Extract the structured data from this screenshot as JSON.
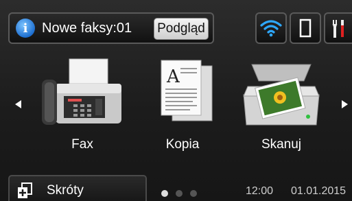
{
  "header": {
    "notification_text": "Nowe faksy:01",
    "preview_label": "Podgląd",
    "info_icon": "info-icon",
    "wifi_icon": "wifi-icon",
    "toner_icon": "toner-icon",
    "settings_icon": "settings-tools-icon"
  },
  "tiles": [
    {
      "label": "Fax",
      "icon": "fax-machine-icon"
    },
    {
      "label": "Kopia",
      "icon": "copy-documents-icon"
    },
    {
      "label": "Skanuj",
      "icon": "scanner-icon"
    }
  ],
  "footer": {
    "shortcuts_label": "Skróty",
    "time": "12:00",
    "date": "01.01.2015",
    "page_count": 3,
    "active_page": 1
  },
  "colors": {
    "wifi": "#2ea8ff",
    "tools_accent": "#e02020",
    "info": "#1e6fd0"
  }
}
